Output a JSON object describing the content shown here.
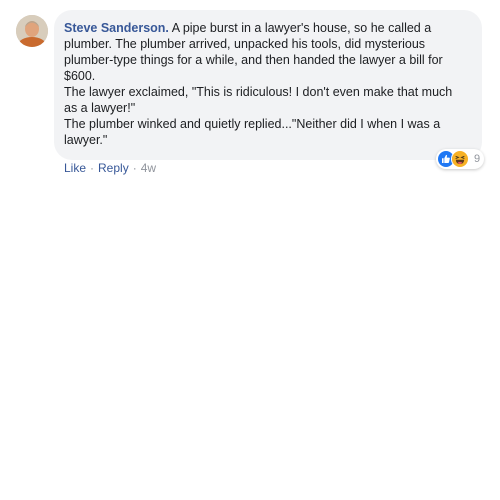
{
  "comment": {
    "author": "Steve Sanderson.",
    "lines": [
      "A pipe burst in a lawyer's house, so he called a",
      "plumber. The plumber arrived, unpacked his tools, did mysterious",
      "plumber-type things for a while, and then handed the lawyer a bill for",
      "$600.",
      "The lawyer exclaimed, \"This is ridiculous! I don't even make that much",
      "as a lawyer!\"",
      "The plumber winked and quietly replied...\"Neither did I when I was a",
      "lawyer.\""
    ]
  },
  "reactions": {
    "icons": [
      "like-icon",
      "haha-icon"
    ],
    "count": "9"
  },
  "actions": {
    "like": "Like",
    "reply": "Reply",
    "time": "4w",
    "separator": "·"
  },
  "colors": {
    "link": "#385898",
    "meta": "#90949c",
    "bubble": "#f2f3f5",
    "like_blue": "#2078f4",
    "haha_yellow": "#f7b125"
  }
}
